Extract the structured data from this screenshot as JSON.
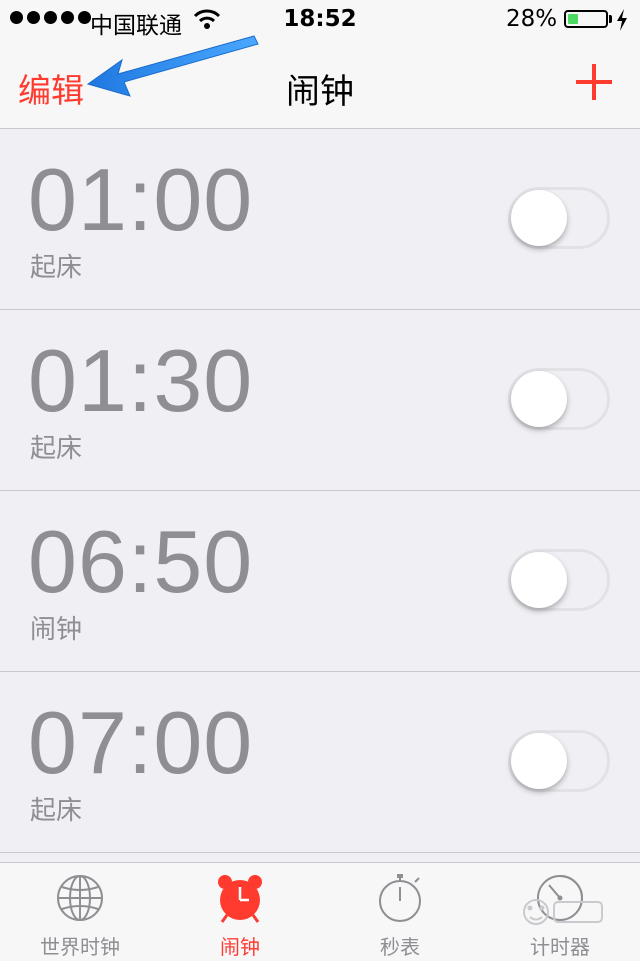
{
  "status_bar": {
    "carrier": "中国联通",
    "time": "18:52",
    "battery_percent_text": "28%",
    "battery_level": 0.28
  },
  "nav": {
    "edit_label": "编辑",
    "title": "闹钟"
  },
  "alarms": [
    {
      "time": "01:00",
      "label": "起床",
      "enabled": false
    },
    {
      "time": "01:30",
      "label": "起床",
      "enabled": false
    },
    {
      "time": "06:50",
      "label": "闹钟",
      "enabled": false
    },
    {
      "time": "07:00",
      "label": "起床",
      "enabled": false
    }
  ],
  "tabs": [
    {
      "label": "世界时钟",
      "icon": "globe-icon",
      "active": false
    },
    {
      "label": "闹钟",
      "icon": "alarm-clock-icon",
      "active": true
    },
    {
      "label": "秒表",
      "icon": "stopwatch-icon",
      "active": false
    },
    {
      "label": "计时器",
      "icon": "timer-icon",
      "active": false
    }
  ],
  "colors": {
    "accent": "#ff3b30",
    "annotation_arrow": "#2a8cf0",
    "battery_fill": "#4cd964"
  }
}
